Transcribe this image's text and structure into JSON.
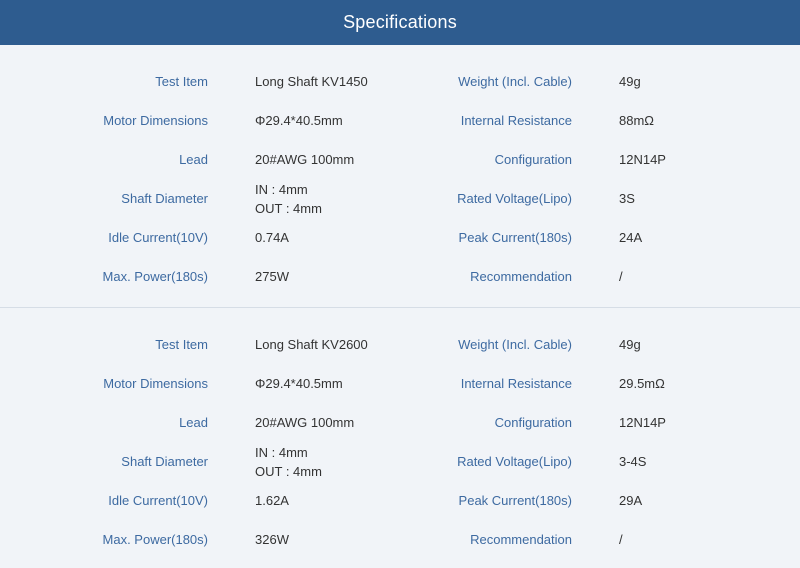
{
  "header": {
    "title": "Specifications"
  },
  "blocks": [
    {
      "rows": [
        {
          "label1": "Test Item",
          "value1": "Long Shaft KV1450",
          "label2": "Weight (Incl. Cable)",
          "value2": "49g"
        },
        {
          "label1": "Motor Dimensions",
          "value1": "Φ29.4*40.5mm",
          "label2": "Internal Resistance",
          "value2": "88mΩ"
        },
        {
          "label1": "Lead",
          "value1": "20#AWG 100mm",
          "label2": "Configuration",
          "value2": "12N14P"
        },
        {
          "label1": "Shaft Diameter",
          "value1a": "IN : 4mm",
          "value1b": "OUT : 4mm",
          "label2": "Rated Voltage(Lipo)",
          "value2": "3S"
        },
        {
          "label1": "Idle Current(10V)",
          "value1": "0.74A",
          "label2": "Peak Current(180s)",
          "value2": "24A"
        },
        {
          "label1": "Max. Power(180s)",
          "value1": "275W",
          "label2": "Recommendation",
          "value2": "/"
        }
      ]
    },
    {
      "rows": [
        {
          "label1": "Test Item",
          "value1": "Long Shaft KV2600",
          "label2": "Weight (Incl. Cable)",
          "value2": "49g"
        },
        {
          "label1": "Motor Dimensions",
          "value1": "Φ29.4*40.5mm",
          "label2": "Internal Resistance",
          "value2": "29.5mΩ"
        },
        {
          "label1": "Lead",
          "value1": "20#AWG 100mm",
          "label2": "Configuration",
          "value2": "12N14P"
        },
        {
          "label1": "Shaft Diameter",
          "value1a": "IN : 4mm",
          "value1b": "OUT : 4mm",
          "label2": "Rated Voltage(Lipo)",
          "value2": "3-4S"
        },
        {
          "label1": "Idle Current(10V)",
          "value1": "1.62A",
          "label2": "Peak Current(180s)",
          "value2": "29A"
        },
        {
          "label1": "Max. Power(180s)",
          "value1": "326W",
          "label2": "Recommendation",
          "value2": "/"
        }
      ]
    }
  ],
  "colors": {
    "header_bg": "#2e5c8f",
    "label": "#3d6aa1",
    "value": "#333333",
    "page_bg": "#f1f4f8"
  }
}
